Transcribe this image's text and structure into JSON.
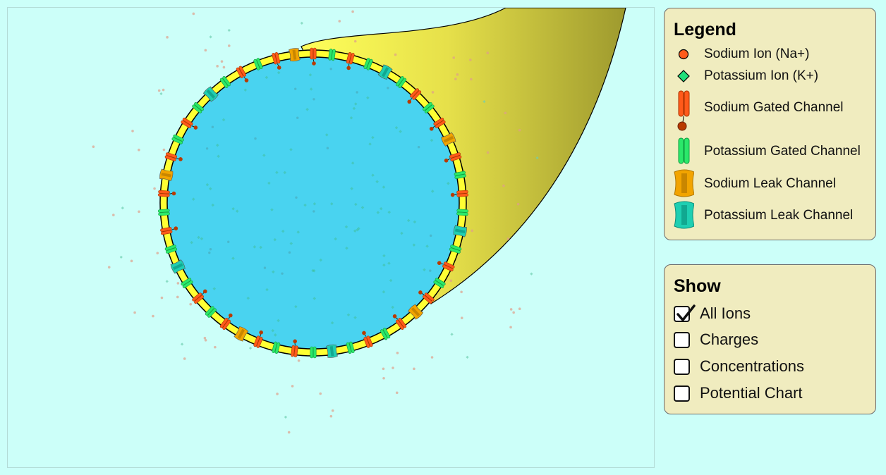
{
  "legend": {
    "title": "Legend",
    "items": [
      {
        "label": "Sodium Ion (Na+)",
        "icon": "sodium-ion-icon",
        "color": "#ff5a1a"
      },
      {
        "label": "Potassium Ion (K+)",
        "icon": "potassium-ion-icon",
        "color": "#22e07a"
      },
      {
        "label": "Sodium Gated Channel",
        "icon": "sodium-gated-channel-icon",
        "color": "#ff5a1a"
      },
      {
        "label": "Potassium Gated Channel",
        "icon": "potassium-gated-channel-icon",
        "color": "#2be86a"
      },
      {
        "label": "Sodium Leak Channel",
        "icon": "sodium-leak-channel-icon",
        "color": "#f2a400"
      },
      {
        "label": "Potassium Leak Channel",
        "icon": "potassium-leak-channel-icon",
        "color": "#1ecfb2"
      }
    ]
  },
  "show": {
    "title": "Show",
    "options": [
      {
        "label": "All Ions",
        "checked": true
      },
      {
        "label": "Charges",
        "checked": false
      },
      {
        "label": "Concentrations",
        "checked": false
      },
      {
        "label": "Potential Chart",
        "checked": false
      }
    ]
  },
  "colors": {
    "background": "#ccfff9",
    "cell_interior": "#49d3f0",
    "membrane": "#ffff33",
    "axon_light": "#ffff55",
    "axon_dark": "#9e9a2e",
    "sodium": "#ff5a1a",
    "potassium": "#22e07a",
    "sodium_leak": "#f2a400",
    "potassium_leak": "#1ecfb2"
  }
}
